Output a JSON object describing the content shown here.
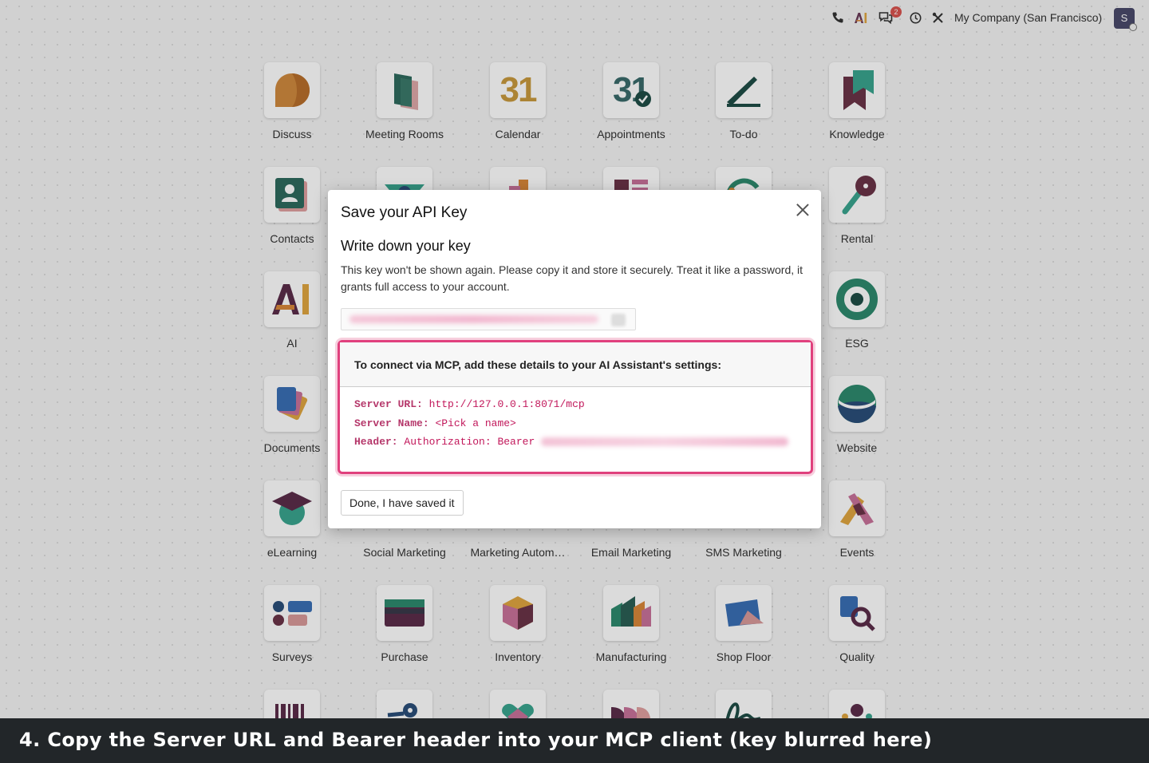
{
  "topbar": {
    "phone_icon": "phone-icon",
    "ai_icon": "ai-icon",
    "messages_badge": "2",
    "company": "My Company (San Francisco)",
    "avatar_initial": "S"
  },
  "apps": [
    {
      "label": "Discuss"
    },
    {
      "label": "Meeting Rooms"
    },
    {
      "label": "Calendar"
    },
    {
      "label": "Appointments"
    },
    {
      "label": "To-do"
    },
    {
      "label": "Knowledge"
    },
    {
      "label": "Contacts"
    },
    {
      "label": "Rental"
    },
    {
      "label": "AI"
    },
    {
      "label": "ESG"
    },
    {
      "label": "Documents"
    },
    {
      "label": "Website"
    },
    {
      "label": "eLearning"
    },
    {
      "label": "Social Marketing"
    },
    {
      "label": "Marketing Autom…"
    },
    {
      "label": "Email Marketing"
    },
    {
      "label": "SMS Marketing"
    },
    {
      "label": "Events"
    },
    {
      "label": "Surveys"
    },
    {
      "label": "Purchase"
    },
    {
      "label": "Inventory"
    },
    {
      "label": "Manufacturing"
    },
    {
      "label": "Shop Floor"
    },
    {
      "label": "Quality"
    }
  ],
  "calendar_tile_text": "31",
  "modal": {
    "title": "Save your API Key",
    "subheading": "Write down your key",
    "description": "This key won't be shown again. Please copy it and store it securely. Treat it like a password, it grants full access to your account.",
    "mcp_heading": "To connect via MCP, add these details to your AI Assistant's settings:",
    "server_url_key": "Server URL:",
    "server_url_value": "http://127.0.0.1:8071/mcp",
    "server_name_key": "Server Name:",
    "server_name_value": "<Pick a name>",
    "header_key": "Header:",
    "header_value": "Authorization: Bearer",
    "done_label": "Done, I have saved it"
  },
  "caption": "4. Copy the Server URL and Bearer header into your MCP client (key blurred here)"
}
